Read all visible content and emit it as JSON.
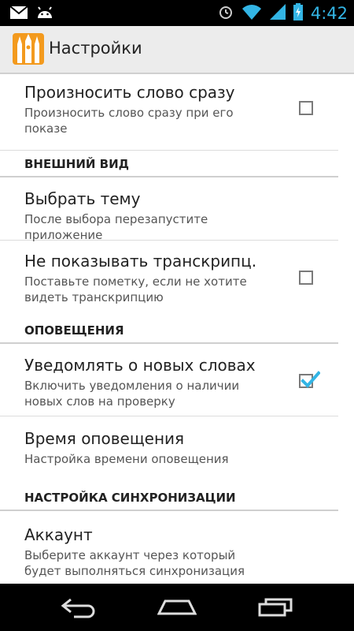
{
  "status_bar": {
    "time": "4:42",
    "icons": [
      "gmail-icon",
      "android-icon",
      "alarm-icon",
      "wifi-icon",
      "signal-icon",
      "battery-charging-icon"
    ]
  },
  "action_bar": {
    "title": "Настройки"
  },
  "preferences": {
    "speak_word": {
      "title": "Произносить слово сразу",
      "summary": "Произносить слово сразу при его показе",
      "checked": false
    },
    "cat_appearance": "ВНЕШНИЙ ВИД",
    "choose_theme": {
      "title": "Выбрать тему",
      "summary": "После выбора перезапустите приложение"
    },
    "hide_transcription": {
      "title": "Не показывать транскрипц.",
      "summary": "Поставьте пометку, если не хотите видеть транскрипцию",
      "checked": false
    },
    "cat_notifications": "ОПОВЕЩЕНИЯ",
    "notify_new_words": {
      "title": "Уведомлять о новых словах",
      "summary": "Включить уведомления о наличии новых слов на проверку",
      "checked": true
    },
    "notify_time": {
      "title": "Время оповещения",
      "summary": "Настройка времени оповещения"
    },
    "cat_sync": "НАСТРОЙКА СИНХРОНИЗАЦИИ",
    "account": {
      "title": "Аккаунт",
      "summary": "Выберите аккаунт через который будет выполняться синхронизация"
    }
  },
  "colors": {
    "accent": "#33b5e5",
    "app_icon": "#f39a1e"
  },
  "nav_bar": {
    "icons": [
      "back-icon",
      "home-icon",
      "recent-apps-icon"
    ]
  }
}
